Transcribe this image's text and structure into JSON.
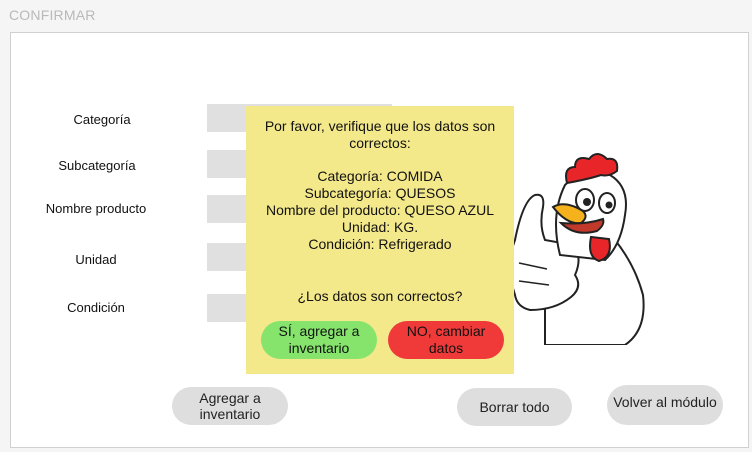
{
  "window": {
    "title": "CONFIRMAR"
  },
  "form": {
    "fields": [
      {
        "label": "Categoría",
        "value": ""
      },
      {
        "label": "Subcategoría",
        "value": ""
      },
      {
        "label": "Nombre producto",
        "value": ""
      },
      {
        "label": "Unidad",
        "value": ""
      },
      {
        "label": "Condición",
        "value": ""
      }
    ]
  },
  "buttons": {
    "add": "Agregar a inventario",
    "clear": "Borrar todo",
    "back": "Volver al módulo"
  },
  "dialog": {
    "message": "Por favor, verifique que los datos son correctos:",
    "details": [
      "Categoría: COMIDA",
      "Subcategoría: QUESOS",
      "Nombre del producto: QUESO AZUL",
      "Unidad: KG.",
      "Condición: Refrigerado"
    ],
    "question": "¿Los datos son correctos?",
    "confirm_label": "SÍ, agregar a inventario",
    "cancel_label": "NO, cambiar datos",
    "confirm_color": "#86e46d",
    "cancel_color": "#f03a3a",
    "background": "#f4e98a"
  },
  "mascot": {
    "icon": "chicken-thumbs-up-icon"
  }
}
